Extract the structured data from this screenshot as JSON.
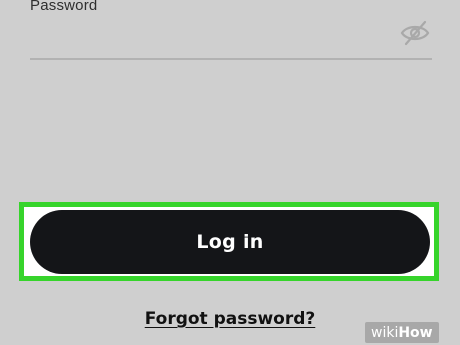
{
  "password_field": {
    "label": "Password",
    "value": "",
    "visibility_icon": "eye-slash-icon"
  },
  "login_button": {
    "label": "Log in"
  },
  "forgot_link": {
    "label": "Forgot password?"
  },
  "highlight": {
    "color": "#36d42b"
  },
  "watermark": {
    "prefix": "wiki",
    "suffix": "How"
  },
  "colors": {
    "background": "#cfcfcf",
    "button": "#141518",
    "button_text": "#ffffff"
  }
}
